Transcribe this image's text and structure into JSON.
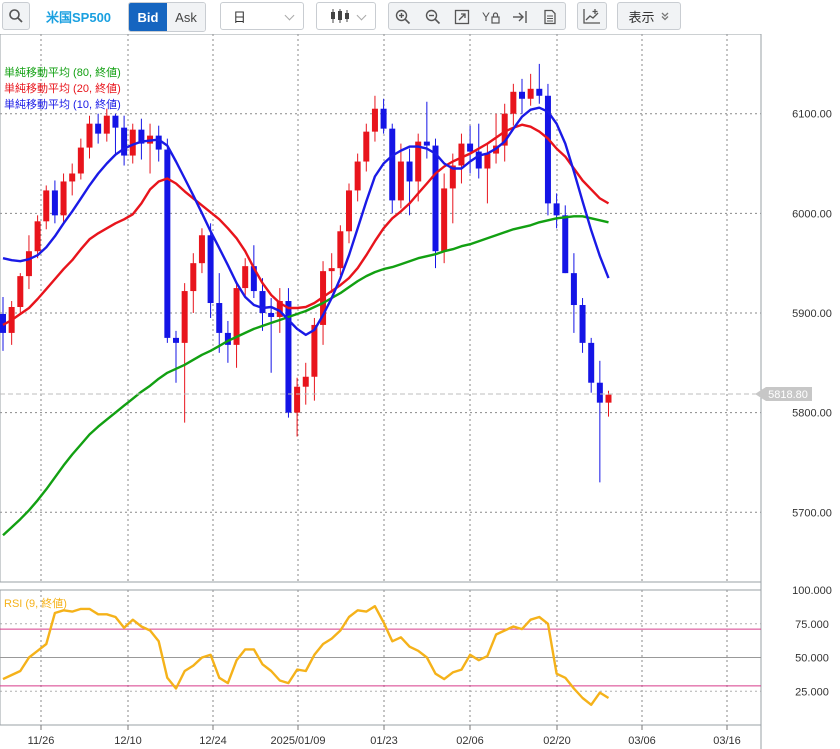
{
  "toolbar": {
    "symbol": "米国SP500",
    "bid_label": "Bid",
    "ask_label": "Ask",
    "period": "日",
    "display_label": "表示"
  },
  "legend": {
    "ma80": "単純移動平均 (80, 終値)",
    "ma20": "単純移動平均 (20, 終値)",
    "ma10": "単純移動平均 (10, 終値)",
    "rsi": "RSI (9, 終値)"
  },
  "current_price_label": "5818.80",
  "colors": {
    "up": "#e8141c",
    "down": "#1414e6",
    "ma80": "#12a012",
    "ma20": "#e8141c",
    "ma10": "#1a1ae6",
    "rsi": "#f5b21a",
    "accent": "#1565c0"
  },
  "chart_data": [
    {
      "type": "candlestick",
      "ylim": [
        5630,
        6180
      ],
      "y_ticks": [
        5700,
        5800,
        5900,
        6000,
        6100
      ],
      "y_tick_labels": [
        "5700.00",
        "5800.00",
        "5900.00",
        "6000.00",
        "6100.00"
      ],
      "x_tick_labels": [
        "11/26",
        "12/10",
        "12/24",
        "2025/01/09",
        "01/23",
        "02/06",
        "02/20",
        "03/06",
        "03/16"
      ],
      "candles": [
        [
          5899,
          5916,
          5862,
          5880
        ],
        [
          5880,
          5912,
          5868,
          5906
        ],
        [
          5906,
          5940,
          5900,
          5937
        ],
        [
          5937,
          5978,
          5924,
          5962
        ],
        [
          5962,
          5998,
          5955,
          5992
        ],
        [
          5992,
          6028,
          5984,
          6023
        ],
        [
          6023,
          6033,
          5990,
          5998
        ],
        [
          5998,
          6040,
          5990,
          6032
        ],
        [
          6032,
          6050,
          6018,
          6040
        ],
        [
          6040,
          6075,
          6034,
          6066
        ],
        [
          6066,
          6098,
          6055,
          6090
        ],
        [
          6090,
          6100,
          6070,
          6080
        ],
        [
          6080,
          6105,
          6072,
          6098
        ],
        [
          6098,
          6100,
          6060,
          6086
        ],
        [
          6086,
          6098,
          6048,
          6058
        ],
        [
          6058,
          6090,
          6050,
          6084
        ],
        [
          6084,
          6095,
          6054,
          6070
        ],
        [
          6070,
          6090,
          6040,
          6078
        ],
        [
          6078,
          6088,
          6052,
          6064
        ],
        [
          6064,
          6075,
          5870,
          5875
        ],
        [
          5875,
          5882,
          5830,
          5870
        ],
        [
          5870,
          5930,
          5790,
          5922
        ],
        [
          5922,
          5960,
          5900,
          5950
        ],
        [
          5950,
          5985,
          5940,
          5978
        ],
        [
          5978,
          5990,
          5895,
          5910
        ],
        [
          5910,
          5940,
          5860,
          5880
        ],
        [
          5880,
          5892,
          5850,
          5868
        ],
        [
          5868,
          5930,
          5845,
          5925
        ],
        [
          5925,
          5955,
          5915,
          5947
        ],
        [
          5947,
          5968,
          5915,
          5922
        ],
        [
          5922,
          5935,
          5882,
          5900
        ],
        [
          5900,
          5915,
          5840,
          5896
        ],
        [
          5896,
          5925,
          5880,
          5912
        ],
        [
          5912,
          5925,
          5795,
          5800
        ],
        [
          5800,
          5835,
          5776,
          5826
        ],
        [
          5826,
          5850,
          5808,
          5836
        ],
        [
          5836,
          5895,
          5812,
          5888
        ],
        [
          5888,
          5952,
          5868,
          5942
        ],
        [
          5942,
          5960,
          5920,
          5945
        ],
        [
          5945,
          5988,
          5938,
          5982
        ],
        [
          5982,
          6030,
          5970,
          6023
        ],
        [
          6023,
          6060,
          6012,
          6052
        ],
        [
          6052,
          6090,
          6042,
          6082
        ],
        [
          6082,
          6118,
          6072,
          6105
        ],
        [
          6105,
          6115,
          6080,
          6085
        ],
        [
          6085,
          6090,
          6000,
          6013
        ],
        [
          6013,
          6070,
          6005,
          6052
        ],
        [
          6052,
          6065,
          5998,
          6032
        ],
        [
          6032,
          6080,
          6012,
          6072
        ],
        [
          6072,
          6112,
          6055,
          6068
        ],
        [
          6068,
          6075,
          5945,
          5962
        ],
        [
          5962,
          6040,
          5950,
          6025
        ],
        [
          6025,
          6060,
          5990,
          6048
        ],
        [
          6048,
          6080,
          6030,
          6070
        ],
        [
          6070,
          6088,
          6040,
          6062
        ],
        [
          6062,
          6090,
          6035,
          6045
        ],
        [
          6045,
          6070,
          6010,
          6060
        ],
        [
          6060,
          6100,
          6050,
          6068
        ],
        [
          6068,
          6110,
          6052,
          6100
        ],
        [
          6100,
          6130,
          6088,
          6122
        ],
        [
          6122,
          6135,
          6100,
          6115
        ],
        [
          6115,
          6140,
          6108,
          6125
        ],
        [
          6125,
          6150,
          6110,
          6118
        ],
        [
          6118,
          6130,
          5998,
          6010
        ],
        [
          6010,
          6020,
          5985,
          5998
        ],
        [
          5998,
          6008,
          5940,
          5940
        ],
        [
          5940,
          5960,
          5880,
          5908
        ],
        [
          5908,
          5915,
          5860,
          5870
        ],
        [
          5870,
          5875,
          5820,
          5830
        ],
        [
          5830,
          5852,
          5730,
          5810
        ],
        [
          5810,
          5822,
          5796,
          5818
        ]
      ],
      "series": [
        {
          "name": "単純移動平均 (80, 終値)",
          "values": [
            5677,
            5685,
            5693,
            5702,
            5712,
            5723,
            5735,
            5747,
            5758,
            5768,
            5778,
            5786,
            5793,
            5800,
            5807,
            5814,
            5821,
            5827,
            5834,
            5840,
            5844,
            5848,
            5853,
            5858,
            5862,
            5867,
            5872,
            5876,
            5880,
            5884,
            5887,
            5890,
            5893,
            5896,
            5899,
            5902,
            5906,
            5910,
            5915,
            5920,
            5926,
            5932,
            5937,
            5941,
            5944,
            5946,
            5949,
            5952,
            5955,
            5957,
            5959,
            5962,
            5964,
            5967,
            5969,
            5972,
            5975,
            5978,
            5981,
            5984,
            5986,
            5988,
            5991,
            5993,
            5995,
            5996,
            5997,
            5997,
            5995,
            5993,
            5991
          ]
        },
        {
          "name": "単純移動平均 (20, 終値)",
          "values": [
            5888,
            5893,
            5899,
            5905,
            5914,
            5924,
            5934,
            5944,
            5953,
            5964,
            5974,
            5980,
            5985,
            5990,
            5994,
            5999,
            6010,
            6024,
            6032,
            6035,
            6030,
            6022,
            6015,
            6008,
            6001,
            5994,
            5985,
            5975,
            5962,
            5945,
            5930,
            5918,
            5910,
            5905,
            5905,
            5906,
            5910,
            5916,
            5922,
            5928,
            5935,
            5945,
            5958,
            5972,
            5985,
            5995,
            6002,
            6010,
            6020,
            6030,
            6040,
            6047,
            6052,
            6056,
            6060,
            6065,
            6070,
            6076,
            6082,
            6086,
            6089,
            6087,
            6082,
            6075,
            6065,
            6057,
            6045,
            6033,
            6024,
            6015,
            6010
          ]
        },
        {
          "name": "単純移動平均 (10, 終値)",
          "values": [
            5955,
            5953,
            5952,
            5954,
            5958,
            5966,
            5977,
            5990,
            6002,
            6015,
            6028,
            6040,
            6050,
            6059,
            6065,
            6069,
            6072,
            6073,
            6074,
            6068,
            6052,
            6035,
            6018,
            6000,
            5982,
            5965,
            5948,
            5930,
            5916,
            5908,
            5905,
            5906,
            5902,
            5893,
            5884,
            5878,
            5883,
            5898,
            5915,
            5935,
            5958,
            5985,
            6012,
            6037,
            6050,
            6058,
            6063,
            6067,
            6067,
            6065,
            6060,
            6050,
            6045,
            6045,
            6052,
            6058,
            6060,
            6065,
            6072,
            6085,
            6097,
            6104,
            6106,
            6102,
            6090,
            6070,
            6042,
            6012,
            5983,
            5957,
            5935
          ]
        }
      ]
    },
    {
      "type": "line",
      "ylim": [
        0,
        100
      ],
      "y_ticks": [
        25,
        50,
        75,
        100
      ],
      "y_tick_labels": [
        "25.000",
        "50.000",
        "75.000",
        "100.000"
      ],
      "series": [
        {
          "name": "RSI (9, 終値)",
          "values": [
            34,
            37,
            40,
            50,
            55,
            60,
            83,
            85,
            84,
            86,
            86,
            82,
            82,
            80,
            72,
            78,
            73,
            70,
            62,
            35,
            27,
            40,
            44,
            50,
            52,
            35,
            31,
            48,
            56,
            56,
            45,
            40,
            33,
            31,
            41,
            40,
            52,
            60,
            64,
            70,
            80,
            85,
            84,
            88,
            76,
            62,
            65,
            58,
            55,
            50,
            38,
            34,
            39,
            41,
            52,
            48,
            51,
            67,
            70,
            73,
            71,
            78,
            80,
            75,
            38,
            35,
            27,
            20,
            15,
            24,
            20
          ]
        },
        {
          "name": "",
          "values": [
            71
          ]
        },
        {
          "name": "",
          "values": [
            29
          ]
        }
      ]
    }
  ]
}
